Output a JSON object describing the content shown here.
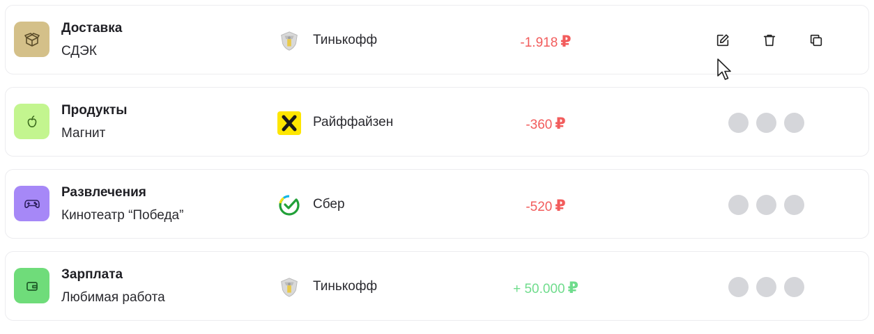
{
  "transactions": [
    {
      "category": "Доставка",
      "merchant": "СДЭК",
      "category_icon": "box-icon",
      "category_color": "#d4c089",
      "bank": "Тинькофф",
      "bank_logo": "tinkoff-logo",
      "amount": "-1.918",
      "currency": "₽",
      "amount_color": "#f25c5c",
      "actions_visible": true
    },
    {
      "category": "Продукты",
      "merchant": "Магнит",
      "category_icon": "apple-icon",
      "category_color": "#c3f58f",
      "bank": "Райффайзен",
      "bank_logo": "raiffeisen-logo",
      "amount": "-360",
      "currency": "₽",
      "amount_color": "#f25c5c",
      "actions_visible": false
    },
    {
      "category": "Развлечения",
      "merchant": "Кинотеатр “Победа”",
      "category_icon": "gamepad-icon",
      "category_color": "#a688f7",
      "bank": "Сбер",
      "bank_logo": "sber-logo",
      "amount": "-520",
      "currency": "₽",
      "amount_color": "#f25c5c",
      "actions_visible": false
    },
    {
      "category": "Зарплата",
      "merchant": "Любимая работа",
      "category_icon": "wallet-icon",
      "category_color": "#6fdc7a",
      "bank": "Тинькофф",
      "bank_logo": "tinkoff-logo",
      "amount": "+ 50.000",
      "currency": "₽",
      "amount_color": "#6fdc8c",
      "actions_visible": false
    }
  ],
  "row_actions": [
    {
      "name": "edit",
      "icon": "edit-icon"
    },
    {
      "name": "delete",
      "icon": "trash-icon"
    },
    {
      "name": "copy",
      "icon": "copy-icon"
    }
  ]
}
